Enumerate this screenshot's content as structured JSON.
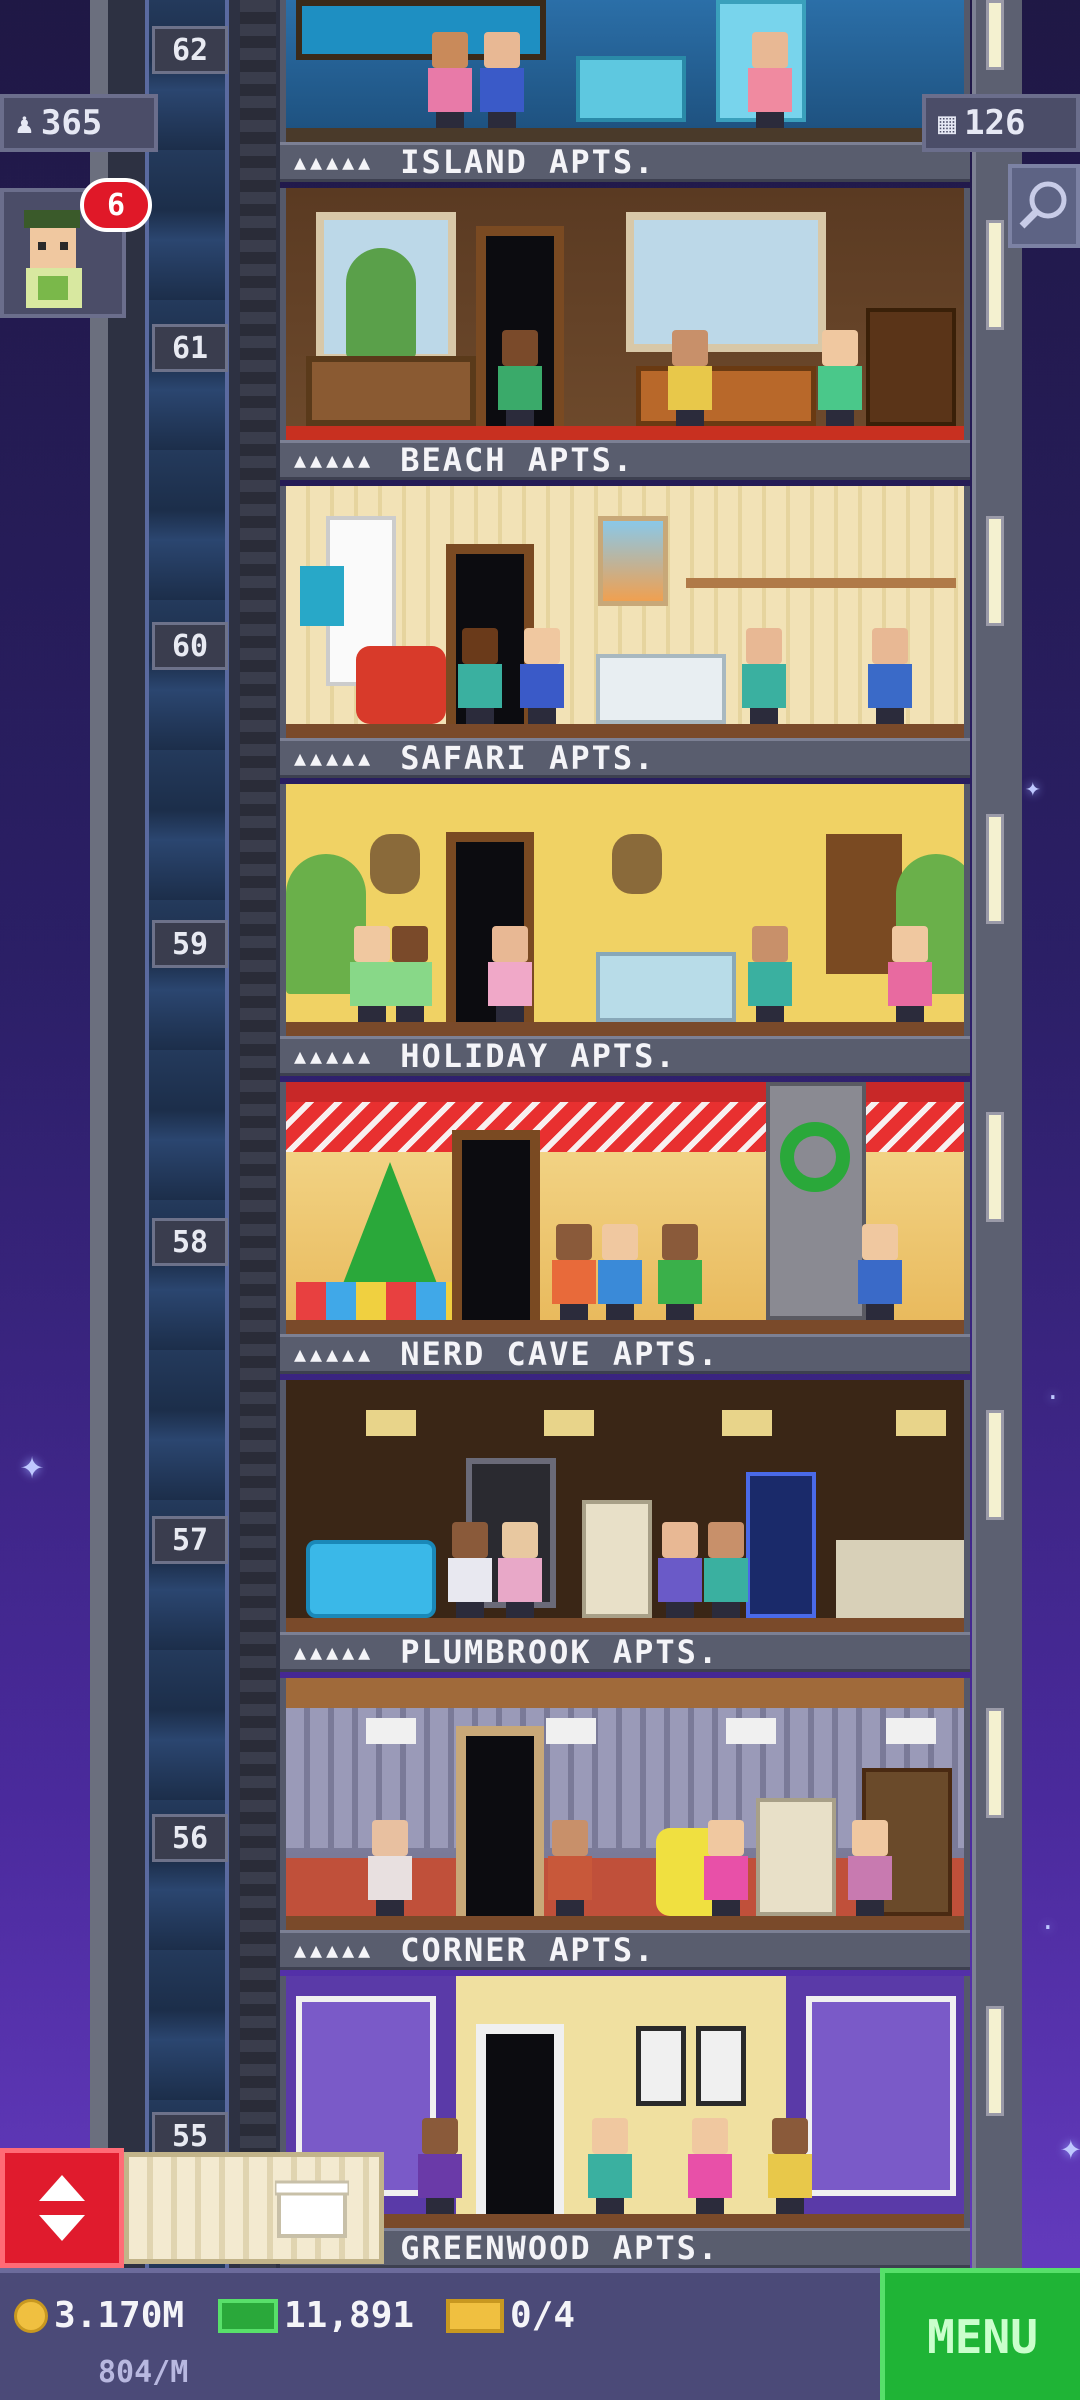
{
  "hud": {
    "population": "365",
    "floors": "126",
    "notifications": "6"
  },
  "floors": [
    {
      "number": "62",
      "name": "ISLAND APTS."
    },
    {
      "number": "61",
      "name": "BEACH APTS."
    },
    {
      "number": "60",
      "name": "SAFARI APTS."
    },
    {
      "number": "59",
      "name": "HOLIDAY APTS."
    },
    {
      "number": "58",
      "name": "NERD CAVE APTS."
    },
    {
      "number": "57",
      "name": "PLUMBROOK APTS."
    },
    {
      "number": "56",
      "name": "CORNER APTS."
    },
    {
      "number": "55",
      "name": "GREENWOOD APTS."
    }
  ],
  "bottom": {
    "coins": "3.170M",
    "coins_rate": "804/M",
    "bux": "11,891",
    "tickets": "0/4",
    "menu_label": "MENU"
  },
  "colors": {
    "menu": "#1fb436",
    "elevator_button": "#e01b2d",
    "badge": "#e01828"
  }
}
